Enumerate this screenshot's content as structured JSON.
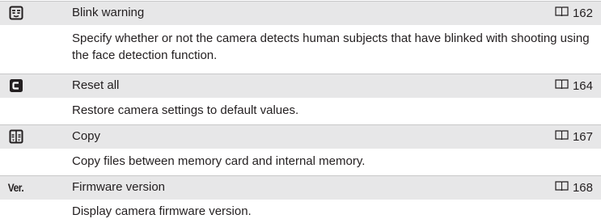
{
  "items": [
    {
      "icon": "blink-warning-icon",
      "title": "Blink warning",
      "page": "162",
      "description": "Specify whether or not the camera detects human subjects that have blinked with shooting using the face detection function."
    },
    {
      "icon": "reset-all-icon",
      "title": "Reset all",
      "page": "164",
      "description": "Restore camera settings to default values."
    },
    {
      "icon": "copy-icon",
      "title": "Copy",
      "page": "167",
      "description": "Copy files between memory card and internal memory."
    },
    {
      "icon": "firmware-version-icon",
      "icon_text": "Ver.",
      "title": "Firmware version",
      "page": "168",
      "description": "Display camera firmware version."
    }
  ]
}
